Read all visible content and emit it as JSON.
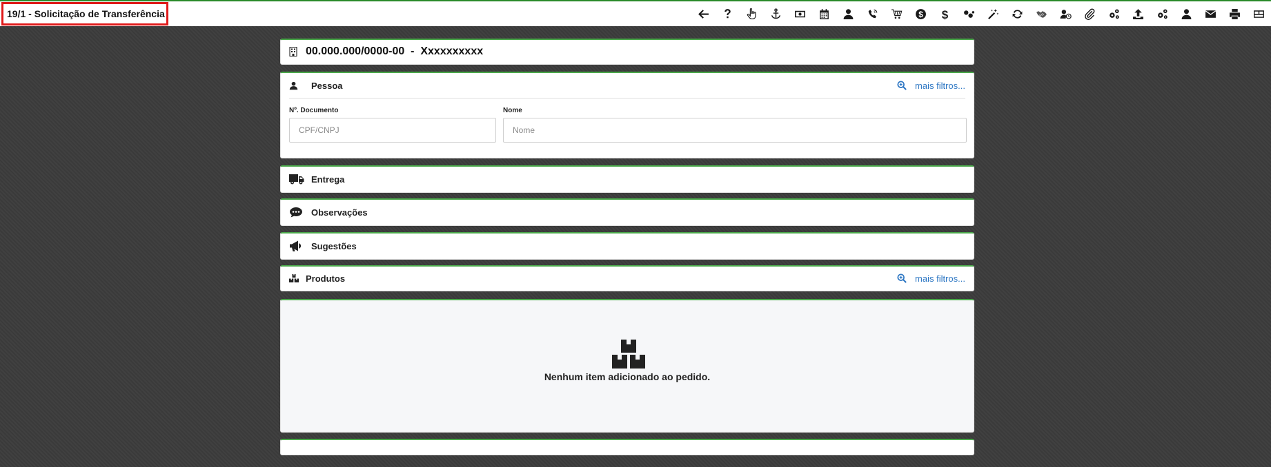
{
  "window": {
    "title": "19/1 - Solicitação de Transferência"
  },
  "toolbar": {
    "icons": [
      "arrow-left-icon",
      "question-icon",
      "hand-pointer-icon",
      "anchor-icon",
      "money-bill-icon",
      "calendar-icon",
      "user-icon",
      "phone-volume-icon",
      "cart-icon",
      "dollar-circle-icon",
      "dollar-icon",
      "dots-icon",
      "magic-icon",
      "sync-icon",
      "handshake-icon",
      "user-clock-icon",
      "paperclip-icon",
      "cogs-icon",
      "upload-icon",
      "cogs-icon-2",
      "user-icon-2",
      "envelope-icon",
      "print-icon",
      "layout-icon"
    ]
  },
  "company": {
    "text": "00.000.000/0000-00  -  Xxxxxxxxxx"
  },
  "pessoa": {
    "title": "Pessoa",
    "more_filters": "mais filtros...",
    "documento": {
      "label": "Nº. Documento",
      "placeholder": "CPF/CNPJ",
      "value": ""
    },
    "nome": {
      "label": "Nome",
      "placeholder": "Nome",
      "value": ""
    }
  },
  "entrega": {
    "title": "Entrega"
  },
  "observacoes": {
    "title": "Observações"
  },
  "sugestoes": {
    "title": "Sugestões"
  },
  "produtos": {
    "title": "Produtos",
    "more_filters": "mais filtros...",
    "empty_message": "Nenhum item adicionado ao pedido."
  },
  "colors": {
    "accent_border": "#4aa84a",
    "link": "#2f78c4",
    "title_highlight": "#e01919",
    "background": "#3c3c3c"
  }
}
